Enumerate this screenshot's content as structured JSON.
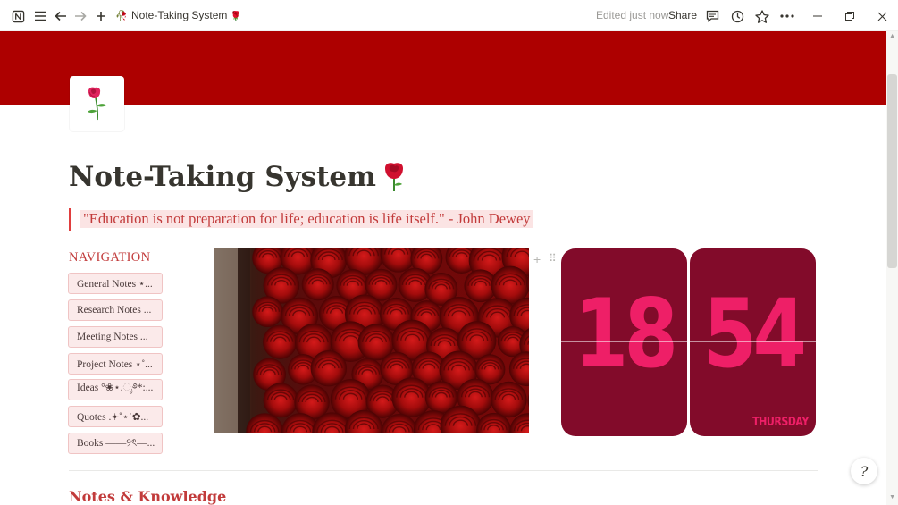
{
  "topbar": {
    "page_title": "Note-Taking System",
    "edited_status": "Edited just now",
    "share_label": "Share",
    "icons": {
      "app": "notion-logo-icon",
      "menu": "hamburger-menu-icon",
      "back": "back-arrow-icon",
      "forward": "forward-arrow-icon",
      "new": "plus-icon",
      "comments": "comment-icon",
      "updates": "clock-history-icon",
      "favorite": "star-icon",
      "more": "more-horizontal-icon",
      "minimize": "minimize-icon",
      "maximize": "restore-icon",
      "close": "close-icon"
    }
  },
  "cover": {
    "color": "#ad0000"
  },
  "page": {
    "icon": "rose-icon",
    "title": "Note-Taking System",
    "title_icon": "red-rose-icon",
    "quote": "\"Education is not preparation for life; education is life itself.\" - John Dewey"
  },
  "navigation": {
    "heading": "NAVIGATION",
    "items": [
      "General Notes ⋆...",
      "Research Notes ...",
      "Meeting Notes ...",
      "Project Notes ⋆˚...",
      "Ideas °❀⋆.ೃ࿔*:...",
      "Quotes .𖥔˚⋆˙✿...",
      "Books ——୨ৎ—..."
    ]
  },
  "photo": {
    "subject": "red-roses-image"
  },
  "clock_widget": {
    "hour": "18",
    "minute": "54",
    "day": "THURSDAY",
    "card_color": "#820b2a",
    "digit_color": "#ee1f67"
  },
  "sections": {
    "notes_heading": "Notes & Knowledge"
  },
  "help": {
    "label": "?"
  }
}
